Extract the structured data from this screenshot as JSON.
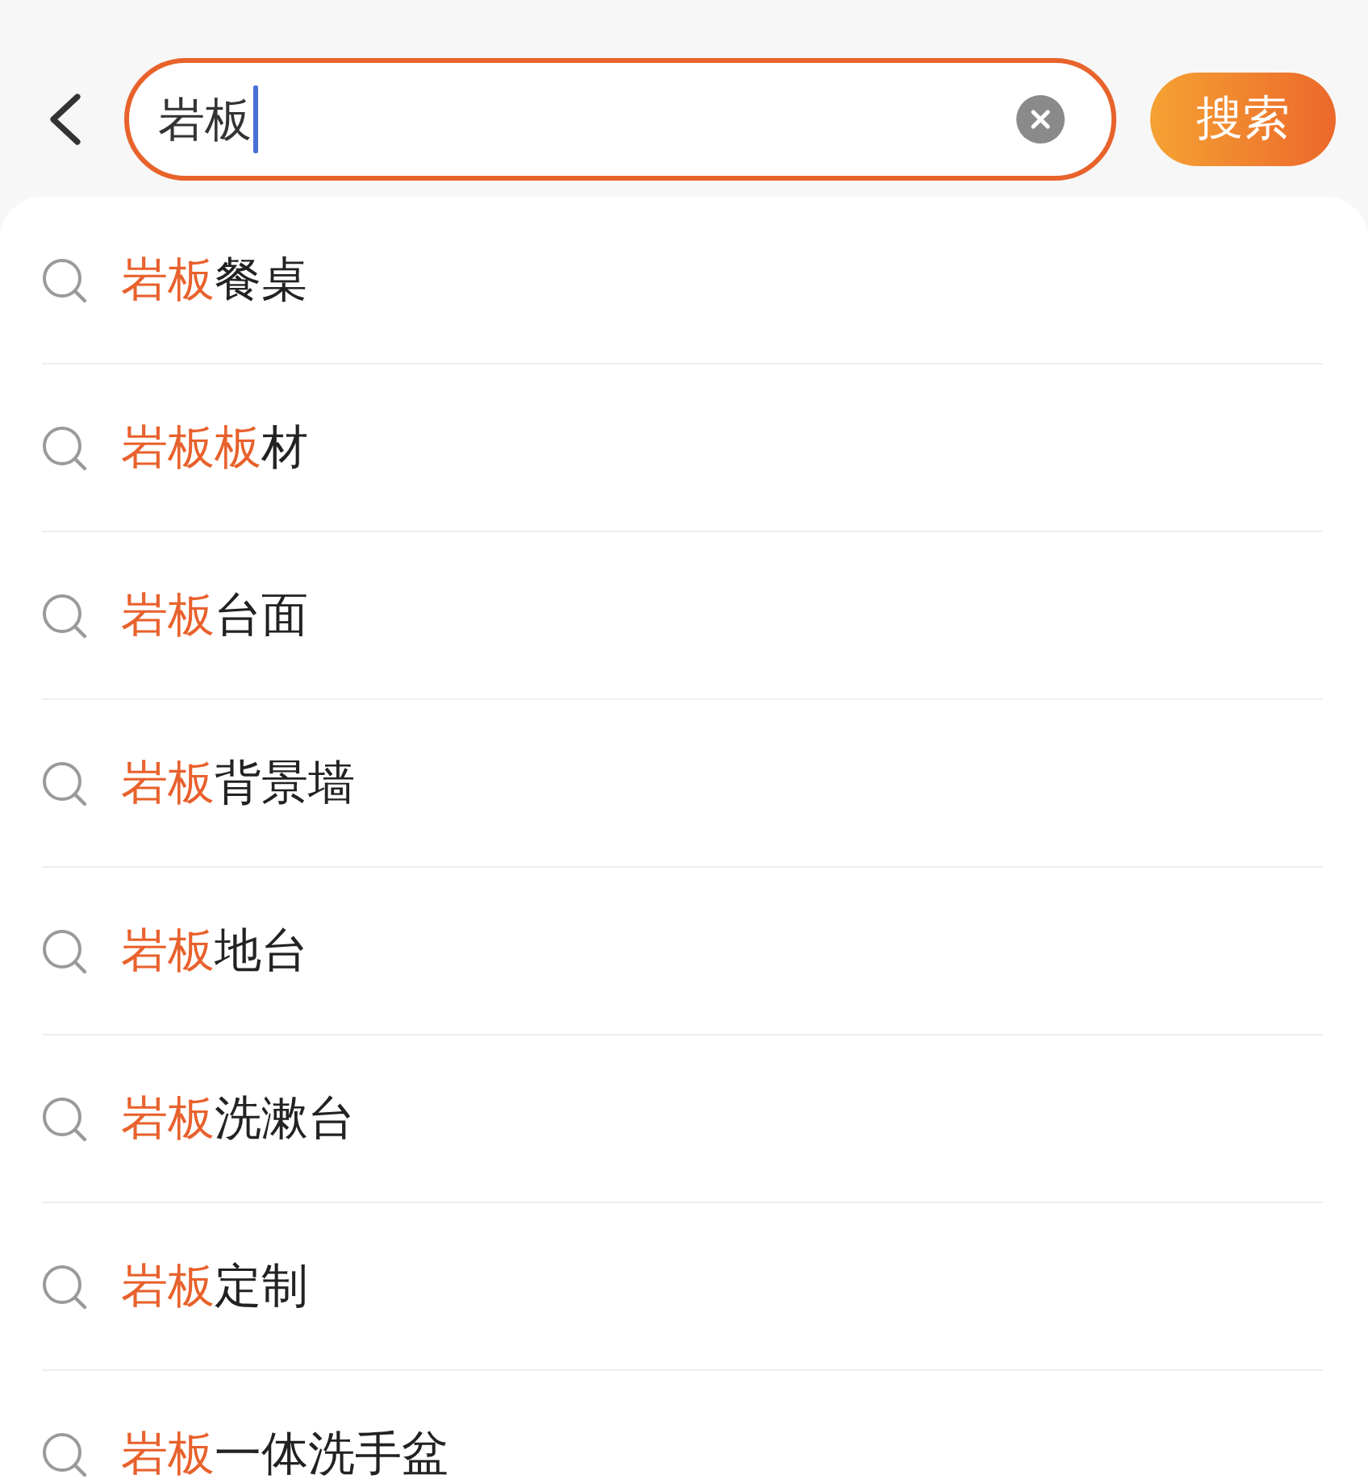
{
  "header": {
    "search_field": {
      "value": "岩板",
      "focused": true
    },
    "search_button": "搜索"
  },
  "suggestions": [
    {
      "match": "岩板",
      "rest": "餐桌"
    },
    {
      "match": "岩板板",
      "rest": "材"
    },
    {
      "match": "岩板",
      "rest": "台面"
    },
    {
      "match": "岩板",
      "rest": "背景墙"
    },
    {
      "match": "岩板",
      "rest": "地台"
    },
    {
      "match": "岩板",
      "rest": "洗漱台"
    },
    {
      "match": "岩板",
      "rest": "定制"
    },
    {
      "match": "岩板",
      "rest": "一体洗手盆"
    }
  ]
}
